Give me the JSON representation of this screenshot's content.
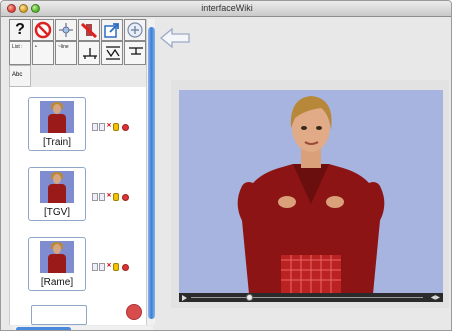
{
  "window": {
    "title": "interfaceWiki"
  },
  "toolbar": {
    "help_label": "?",
    "list_label": "List :",
    "sub_label_1": "•",
    "sub_label_2": "•",
    "sub_label_3": "~line",
    "abc_label": "Abc"
  },
  "signs": [
    {
      "label": "[Train]"
    },
    {
      "label": "[TGV]"
    },
    {
      "label": "[Rame]"
    }
  ],
  "colors": {
    "accent": "#3b7fd8",
    "record": "#d84c4c",
    "video_bg": "#a8b4e0"
  },
  "player": {
    "progress": 0.25
  }
}
